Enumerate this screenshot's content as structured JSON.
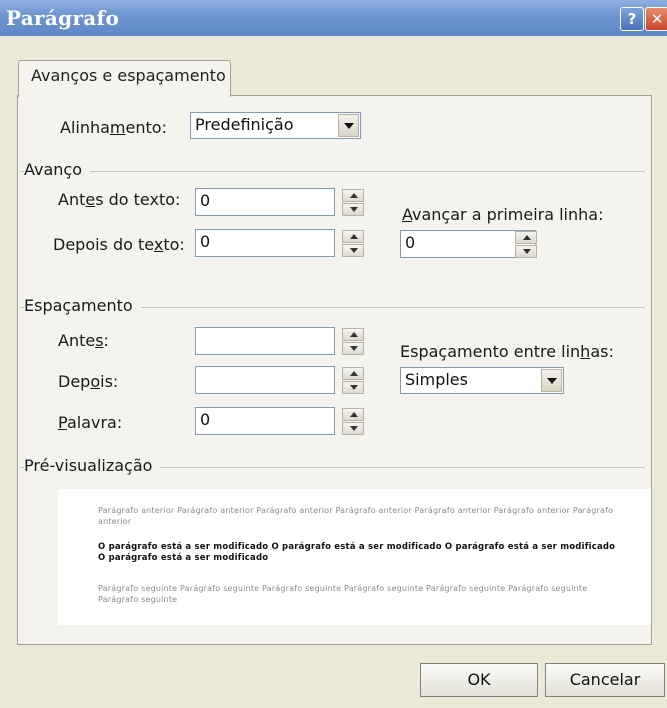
{
  "window": {
    "title": "Parágrafo",
    "help_label": "?",
    "close_label": "✕"
  },
  "tab": {
    "label": "Avanços e espaçamento"
  },
  "alignment": {
    "label_pre": "Alinha",
    "label_u": "m",
    "label_post": "ento:",
    "value": "Predefinição"
  },
  "indent": {
    "group_label": "Avanço",
    "before": {
      "label_pre": "Ant",
      "label_u": "e",
      "label_post": "s do texto:",
      "value": "0"
    },
    "after": {
      "label_pre": "Depois do te",
      "label_u": "x",
      "label_post": "to:",
      "value": "0"
    },
    "first_line": {
      "label_pre": "",
      "label_u": "A",
      "label_post": "vançar a primeira linha:",
      "value": "0"
    }
  },
  "spacing": {
    "group_label": "Espaçamento",
    "before": {
      "label_pre": "Ante",
      "label_u": "s",
      "label_post": ":",
      "value": ""
    },
    "after": {
      "label_pre": "Dep",
      "label_u": "o",
      "label_post": "is:",
      "value": ""
    },
    "word": {
      "label_pre": "",
      "label_u": "P",
      "label_post": "alavra:",
      "value": "0"
    },
    "line": {
      "label_pre": "Espaçamento entre lin",
      "label_u": "h",
      "label_post": "as:",
      "value": "Simples"
    }
  },
  "preview": {
    "group_label": "Pré-visualização",
    "prev_text": "Parágrafo anterior Parágrafo anterior Parágrafo anterior Parágrafo anterior Parágrafo anterior Parágrafo anterior Parágrafo anterior",
    "current_text": "O parágrafo está a ser modificado O parágrafo está a ser modificado O parágrafo está a ser modificado O parágrafo está a ser modificado",
    "next_text": "Parágrafo seguinte Parágrafo seguinte Parágrafo seguinte Parágrafo seguinte Parágrafo seguinte Parágrafo seguinte Parágrafo seguinte"
  },
  "buttons": {
    "ok": "OK",
    "cancel": "Cancelar"
  },
  "colors": {
    "titlebar": "#6f96d2",
    "dialog_bg": "#ece9d8",
    "panel_bg": "#f4f3ee",
    "field_border": "#7f9db9"
  }
}
